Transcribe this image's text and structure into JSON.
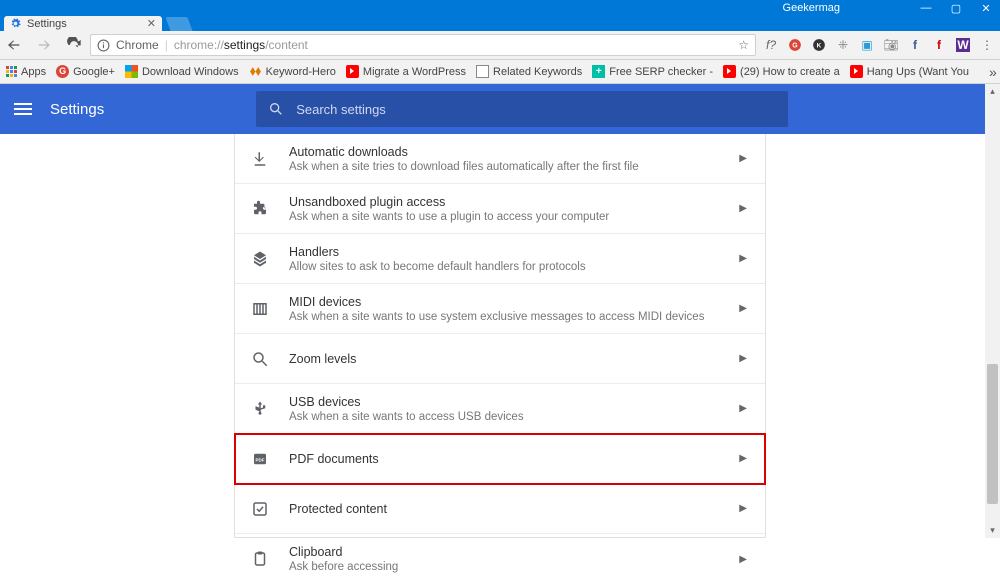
{
  "window": {
    "user": "Geekermag"
  },
  "tab": {
    "title": "Settings"
  },
  "omnibox": {
    "scheme_label": "Chrome",
    "url_prefix": "chrome://",
    "url_bold": "settings",
    "url_suffix": "/content",
    "fp_label": "f?"
  },
  "bookmarks": {
    "apps": "Apps",
    "items": [
      "Google+",
      "Download Windows",
      "Keyword-Hero",
      "Migrate a WordPress",
      "Related Keywords",
      "Free SERP checker -",
      "(29) How to create a",
      "Hang Ups (Want You"
    ]
  },
  "settings": {
    "title": "Settings",
    "search_placeholder": "Search settings",
    "rows": [
      {
        "title": "Automatic downloads",
        "subtitle": "Ask when a site tries to download files automatically after the first file",
        "icon": "download",
        "highlight": false
      },
      {
        "title": "Unsandboxed plugin access",
        "subtitle": "Ask when a site wants to use a plugin to access your computer",
        "icon": "plugin",
        "highlight": false
      },
      {
        "title": "Handlers",
        "subtitle": "Allow sites to ask to become default handlers for protocols",
        "icon": "handlers",
        "highlight": false
      },
      {
        "title": "MIDI devices",
        "subtitle": "Ask when a site wants to use system exclusive messages to access MIDI devices",
        "icon": "midi",
        "highlight": false
      },
      {
        "title": "Zoom levels",
        "subtitle": "",
        "icon": "zoom",
        "highlight": false
      },
      {
        "title": "USB devices",
        "subtitle": "Ask when a site wants to access USB devices",
        "icon": "usb",
        "highlight": false
      },
      {
        "title": "PDF documents",
        "subtitle": "",
        "icon": "pdf",
        "highlight": true
      },
      {
        "title": "Protected content",
        "subtitle": "",
        "icon": "protected",
        "highlight": false
      },
      {
        "title": "Clipboard",
        "subtitle": "Ask before accessing",
        "icon": "clipboard",
        "highlight": false
      }
    ]
  }
}
